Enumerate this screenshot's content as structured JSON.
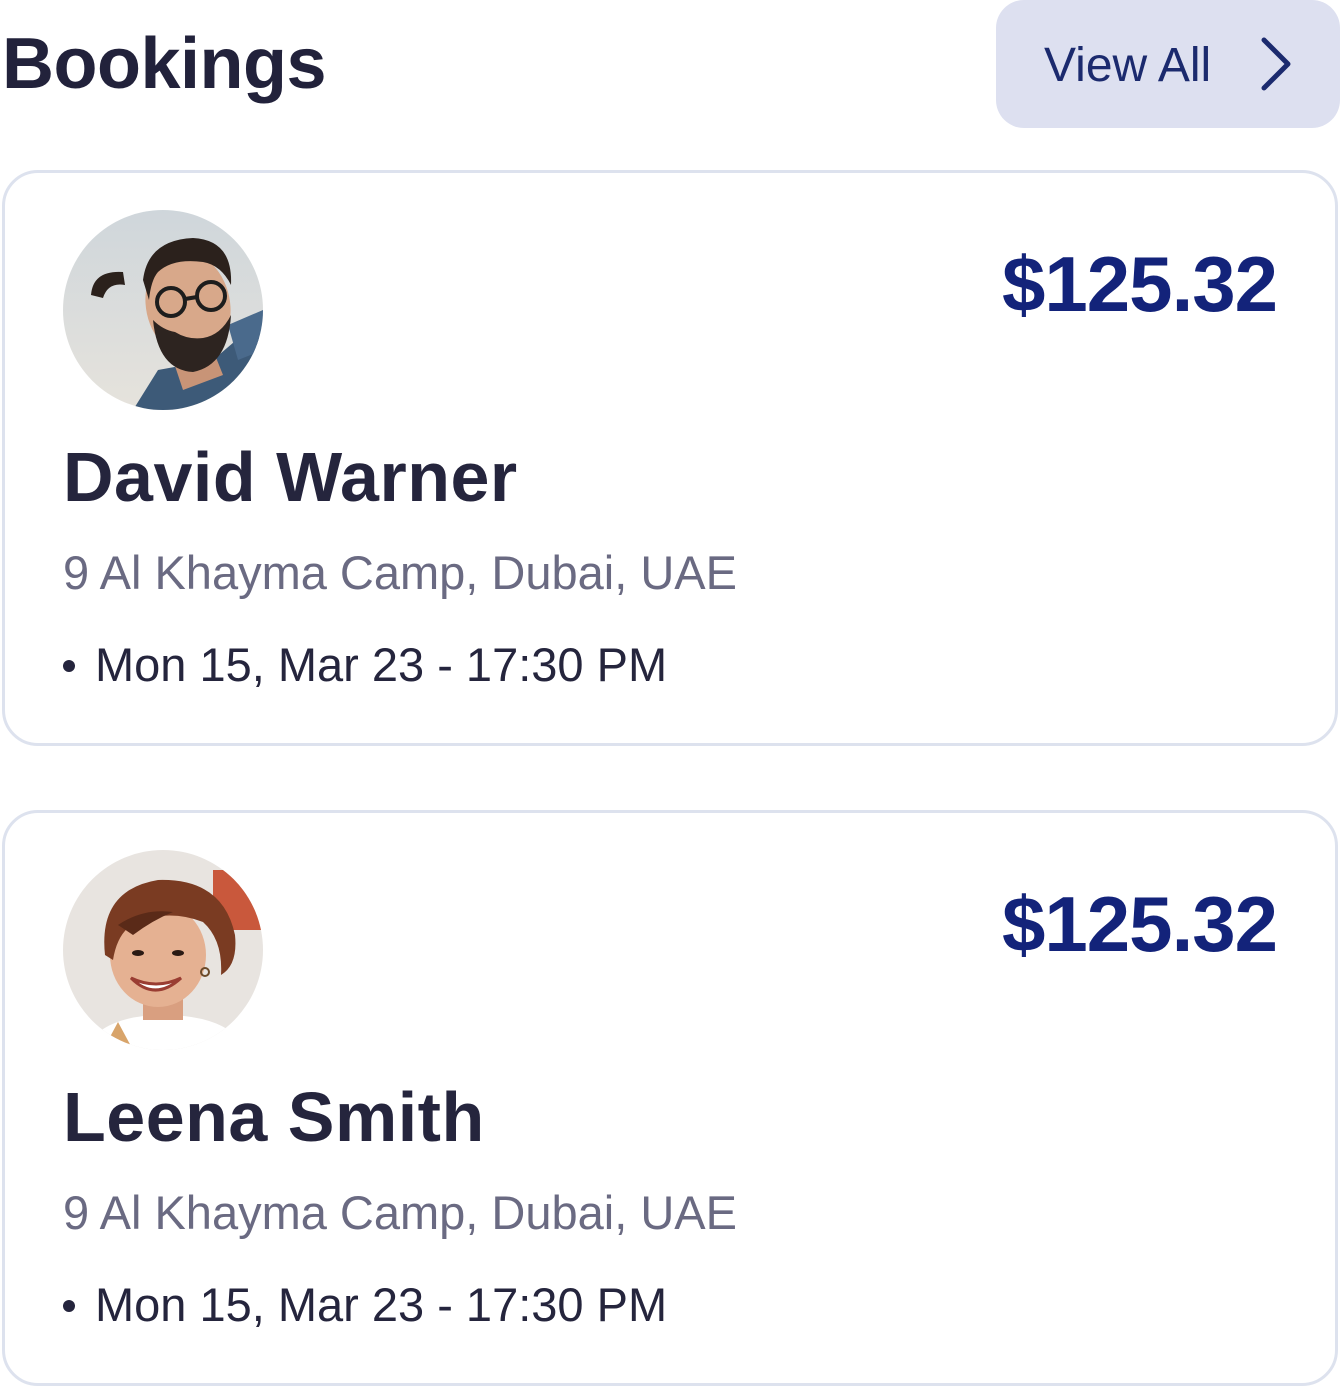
{
  "header": {
    "title": "Bookings",
    "view_all_label": "View All",
    "view_all_icon": "chevron-right-icon"
  },
  "bookings": [
    {
      "name": "David Warner",
      "price": "$125.32",
      "address": "9 Al Khayma Camp, Dubai, UAE",
      "datetime": "Mon 15, Mar 23 - 17:30 PM",
      "avatar": "man-with-glasses-avatar"
    },
    {
      "name": "Leena Smith",
      "price": "$125.32",
      "address": "9 Al Khayma Camp, Dubai, UAE",
      "datetime": "Mon 15, Mar 23 - 17:30 PM",
      "avatar": "smiling-woman-avatar"
    }
  ],
  "colors": {
    "accent": "#13237a",
    "button_bg": "#dde0f0",
    "text_primary": "#25253d",
    "text_secondary": "#6a6a82",
    "card_border": "#dde2ee"
  }
}
